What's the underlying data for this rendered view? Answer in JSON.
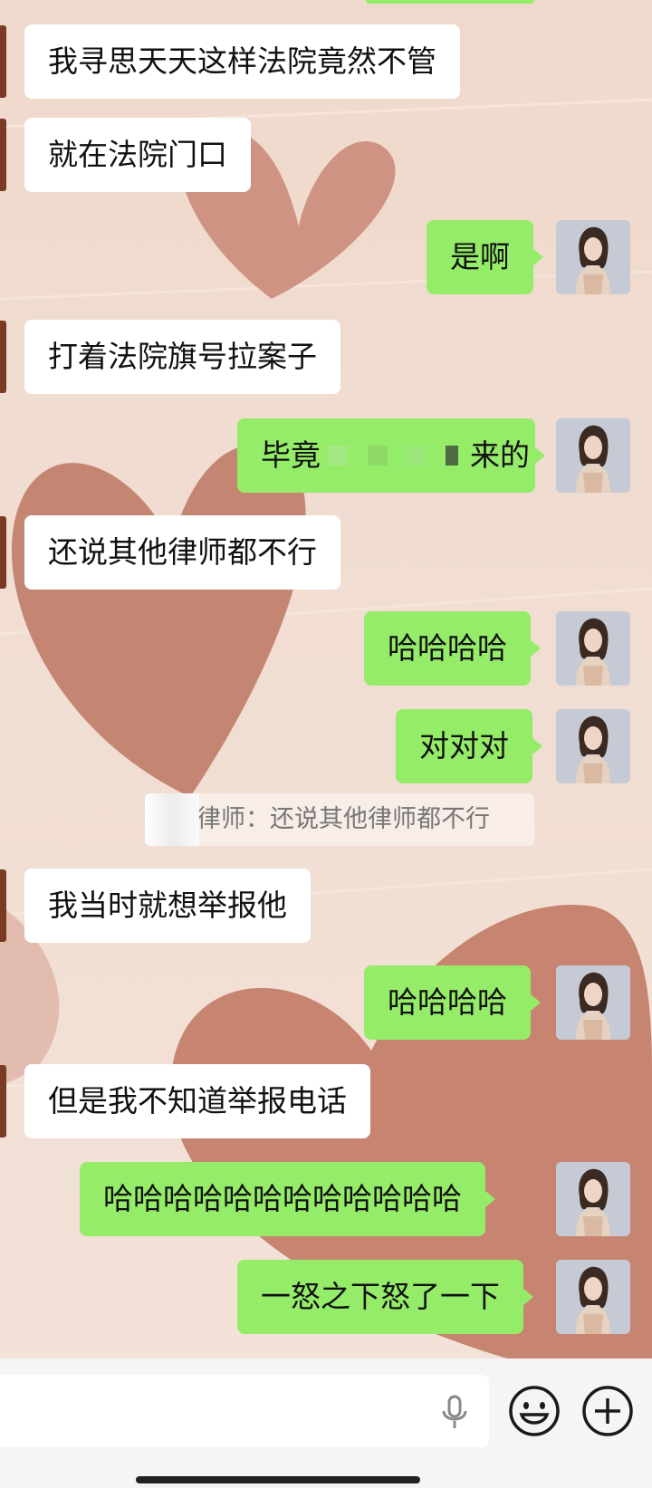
{
  "messages": [
    {
      "side": "in",
      "text": "我寻思天天这样法院竟然不管"
    },
    {
      "side": "in",
      "text": "就在法院门口"
    },
    {
      "side": "out",
      "text": "是啊"
    },
    {
      "side": "in",
      "text": "打着法院旗号拉案子"
    },
    {
      "side": "out",
      "text_before": "毕竟",
      "text_after": "来的"
    },
    {
      "side": "in",
      "text": "还说其他律师都不行"
    },
    {
      "side": "out",
      "text": "哈哈哈哈"
    },
    {
      "side": "out",
      "text": "对对对"
    },
    {
      "side": "quote",
      "text": "律师：还说其他律师都不行"
    },
    {
      "side": "in",
      "text": "我当时就想举报他"
    },
    {
      "side": "out",
      "text": "哈哈哈哈"
    },
    {
      "side": "in",
      "text": "但是我不知道举报电话"
    },
    {
      "side": "out",
      "text": "哈哈哈哈哈哈哈哈哈哈哈哈"
    },
    {
      "side": "out",
      "text": "一怒之下怒了一下"
    }
  ],
  "input_bar": {
    "voice_icon": "microphone-icon",
    "emoji_icon": "smiley-icon",
    "plus_icon": "plus-icon"
  },
  "colors": {
    "outgoing_bubble": "#95ec69",
    "incoming_bubble": "#ffffff",
    "wallpaper": "#f1dccd",
    "heart": "#c57f6c"
  }
}
